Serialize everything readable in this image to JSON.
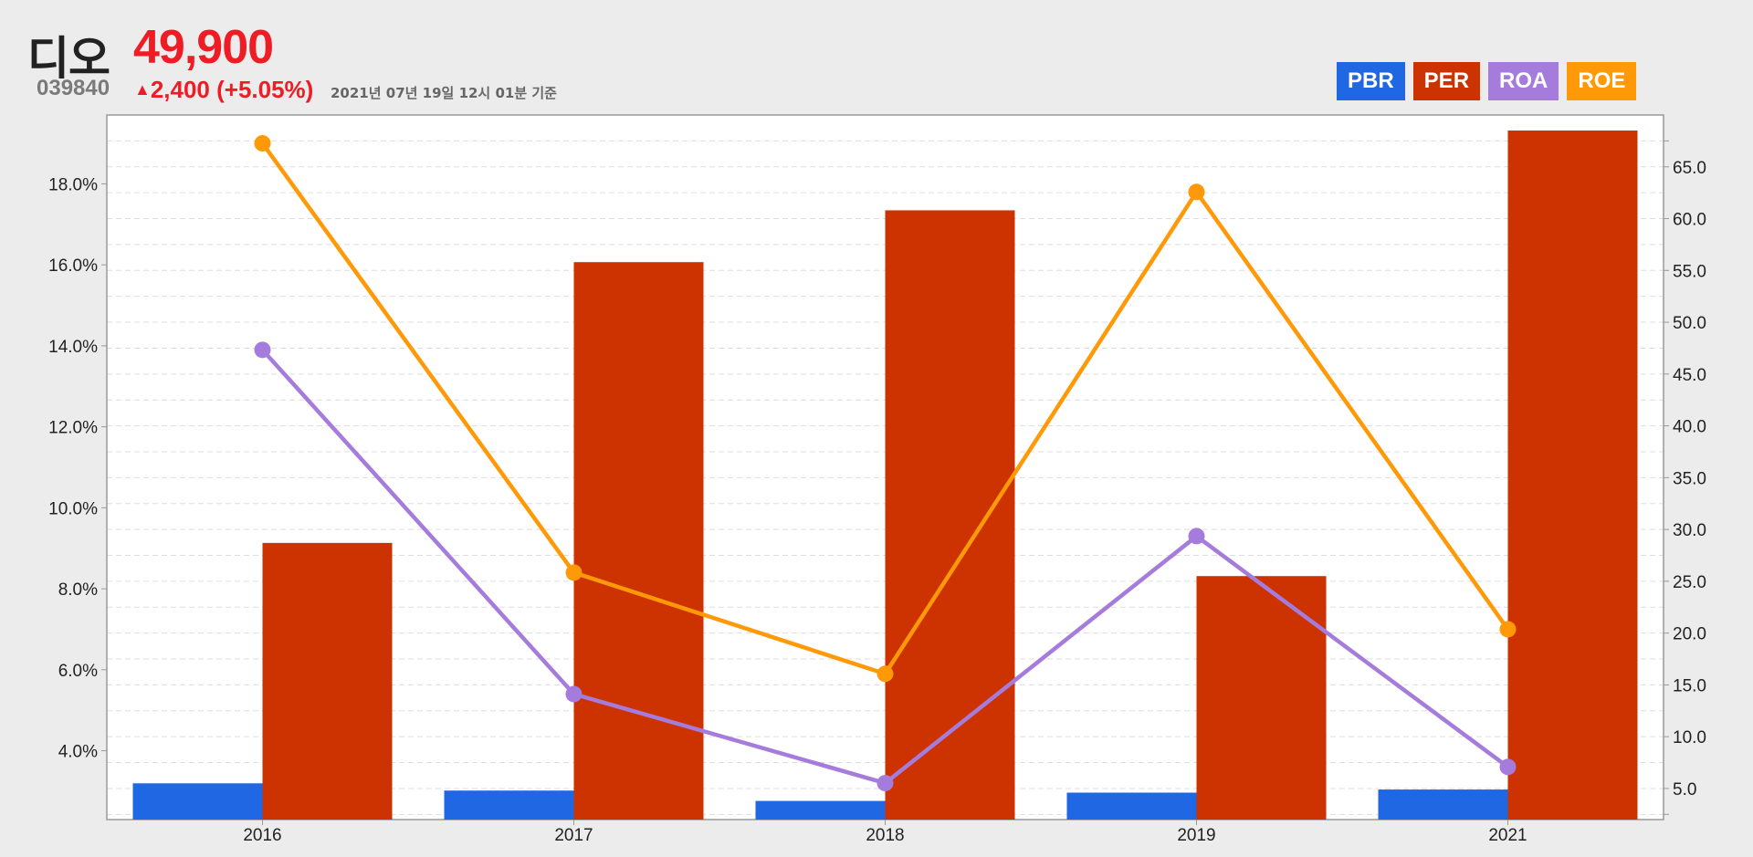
{
  "stock": {
    "name": "디오",
    "price": "49,900",
    "code": "039840",
    "change_arrow": "▲",
    "change": "2,400 (+5.05%)",
    "as_of": "2021년 07년 19일 12시 01분 기준"
  },
  "colors": {
    "PBR": "#1f67e3",
    "PER": "#cc3300",
    "ROA": "#a57cdc",
    "ROE": "#ff9908",
    "price": "#ee1c25"
  },
  "legend": [
    {
      "label": "PBR",
      "color": "#1f67e3"
    },
    {
      "label": "PER",
      "color": "#cc3300"
    },
    {
      "label": "ROA",
      "color": "#a57cdc"
    },
    {
      "label": "ROE",
      "color": "#ff9908"
    }
  ],
  "chart_data": {
    "type": "bar+line",
    "categories": [
      "2016",
      "2017",
      "2018",
      "2019",
      "2021"
    ],
    "left_axis": {
      "ticks": [
        "4.0%",
        "6.0%",
        "8.0%",
        "10.0%",
        "12.0%",
        "14.0%",
        "16.0%",
        "18.0%"
      ],
      "range": [
        2.3,
        19.7
      ]
    },
    "right_axis": {
      "ticks": [
        "5.0",
        "10.0",
        "15.0",
        "20.0",
        "25.0",
        "30.0",
        "35.0",
        "40.0",
        "45.0",
        "50.0",
        "55.0",
        "60.0",
        "65.0"
      ],
      "range": [
        2.0,
        70.0
      ]
    },
    "series": [
      {
        "name": "PBR",
        "type": "bar",
        "axis": "right",
        "values": [
          5.5,
          4.8,
          3.8,
          4.6,
          4.9
        ]
      },
      {
        "name": "PER",
        "type": "bar",
        "axis": "right",
        "values": [
          28.7,
          55.8,
          60.8,
          25.5,
          68.5
        ]
      },
      {
        "name": "ROA",
        "type": "line",
        "axis": "left",
        "values": [
          13.9,
          5.4,
          3.2,
          9.3,
          3.6
        ]
      },
      {
        "name": "ROE",
        "type": "line",
        "axis": "left",
        "values": [
          19.0,
          8.4,
          5.9,
          17.8,
          7.0
        ]
      }
    ],
    "grid": true,
    "legend_position": "top-right"
  }
}
